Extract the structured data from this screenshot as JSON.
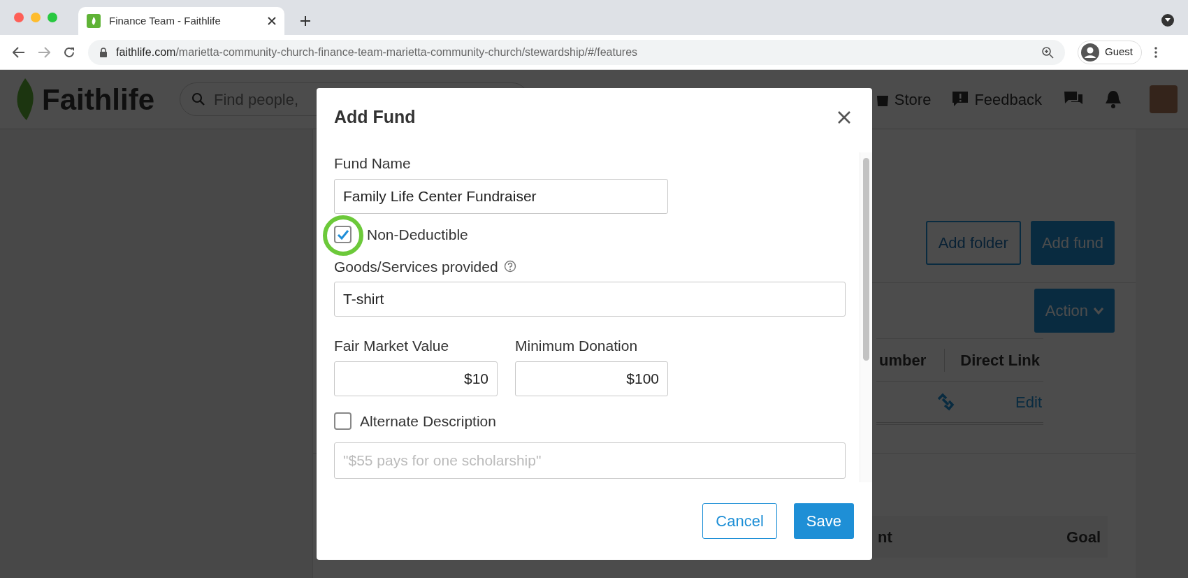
{
  "browser": {
    "tab_title": "Finance Team - Faithlife",
    "url_host": "faithlife.com",
    "url_path": "/marietta-community-church-finance-team-marietta-community-church/stewardship/#/features",
    "profile": "Guest"
  },
  "header": {
    "logo": "Faithlife",
    "search_placeholder": "Find people,",
    "nav": [
      {
        "label": "Store"
      },
      {
        "label": "Feedback"
      }
    ]
  },
  "page": {
    "buttons": [
      {
        "label": "Add folder",
        "primary": false
      },
      {
        "label": "Add fund",
        "primary": true
      }
    ],
    "action": "Action",
    "table_columns": [
      "umber",
      "Direct Link"
    ],
    "row_action": "Edit",
    "table2_columns": [
      "nt",
      "Goal"
    ]
  },
  "dialog": {
    "title": "Add Fund",
    "fields": [
      {
        "kind": "text",
        "label": "Fund Name",
        "value": "Family Life Center Fundraiser"
      },
      {
        "kind": "checkbox",
        "label": "Non-Deductible",
        "checked": true,
        "highlighted": true
      },
      {
        "kind": "help_text",
        "label": "Goods/Services provided",
        "value": "T-shirt"
      },
      {
        "kind": "pair",
        "items": [
          {
            "label": "Fair Market Value",
            "value": "$10"
          },
          {
            "label": "Minimum Donation",
            "value": "$100"
          }
        ]
      },
      {
        "kind": "checkbox",
        "label": "Alternate Description",
        "checked": false,
        "highlighted": false
      },
      {
        "kind": "placeholder",
        "placeholder": "\"$55 pays for one scholarship\""
      }
    ],
    "buttons": [
      {
        "label": "Cancel",
        "primary": false
      },
      {
        "label": "Save",
        "primary": true
      }
    ]
  }
}
